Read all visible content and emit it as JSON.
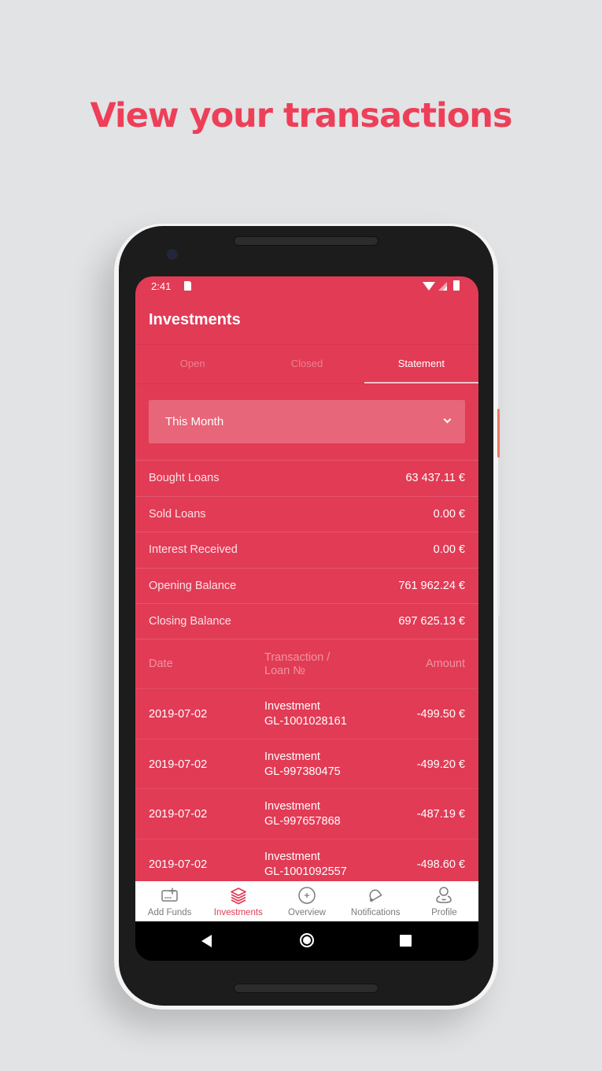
{
  "headline": "View your transactions",
  "status_bar": {
    "time": "2:41"
  },
  "app": {
    "title": "Investments",
    "tabs": [
      {
        "label": "Open",
        "active": false
      },
      {
        "label": "Closed",
        "active": false
      },
      {
        "label": "Statement",
        "active": true
      }
    ],
    "period_select": {
      "value": "This Month"
    },
    "summary": [
      {
        "label": "Bought Loans",
        "value": "63 437.11 €"
      },
      {
        "label": "Sold Loans",
        "value": "0.00 €"
      },
      {
        "label": "Interest Received",
        "value": "0.00 €"
      },
      {
        "label": "Opening Balance",
        "value": "761 962.24 €"
      },
      {
        "label": "Closing Balance",
        "value": "697 625.13 €"
      }
    ],
    "table": {
      "headers": {
        "date": "Date",
        "transaction": "Transaction / Loan №",
        "amount": "Amount"
      },
      "rows": [
        {
          "date": "2019-07-02",
          "type": "Investment",
          "loan": "GL-1001028161",
          "amount": "-499.50  €"
        },
        {
          "date": "2019-07-02",
          "type": "Investment",
          "loan": "GL-997380475",
          "amount": "-499.20  €"
        },
        {
          "date": "2019-07-02",
          "type": "Investment",
          "loan": "GL-997657868",
          "amount": "-487.19  €"
        },
        {
          "date": "2019-07-02",
          "type": "Investment",
          "loan": "GL-1001092557",
          "amount": "-498.60  €"
        }
      ]
    },
    "bottom_nav": [
      {
        "label": "Add Funds",
        "icon": "wallet-add-icon",
        "active": false
      },
      {
        "label": "Investments",
        "icon": "layers-icon",
        "active": true
      },
      {
        "label": "Overview",
        "icon": "plus-circle-icon",
        "active": false
      },
      {
        "label": "Notifications",
        "icon": "bell-icon",
        "active": false
      },
      {
        "label": "Profile",
        "icon": "user-icon",
        "active": false
      }
    ]
  },
  "colors": {
    "brand": "#e23b55",
    "headline": "#ee3f58",
    "nav_inactive": "#7b7b7b"
  }
}
